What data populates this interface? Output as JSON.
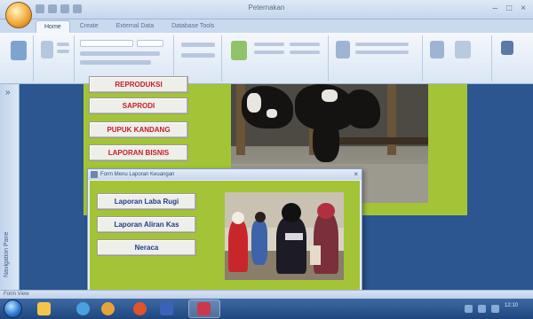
{
  "window": {
    "title": "Peternakan",
    "controls": [
      "–",
      "□",
      "×"
    ]
  },
  "ribbon": {
    "tabs": [
      "Home",
      "Create",
      "External Data",
      "Database Tools"
    ],
    "active_tab": "Home"
  },
  "nav_pane": {
    "label": "Navigation Pane",
    "chevron": "»"
  },
  "main_form": {
    "menu_buttons": [
      "REPRODUKSI",
      "SAPRODI",
      "PUPUK KANDANG",
      "LAPORAN BISNIS"
    ]
  },
  "popup_form": {
    "title": "Form Menu Laporan Keuangan",
    "close": "×",
    "buttons": [
      "Laporan Laba Rugi",
      "Laporan Aliran Kas",
      "Neraca"
    ]
  },
  "status_bar": {
    "text": "Form View"
  },
  "taskbar": {
    "clock": "12:10"
  },
  "colors": {
    "form_background": "#a3c437",
    "workspace": "#2b5690",
    "menu_button_text": "#c4202a",
    "sub_button_text": "#1f3f8a"
  }
}
